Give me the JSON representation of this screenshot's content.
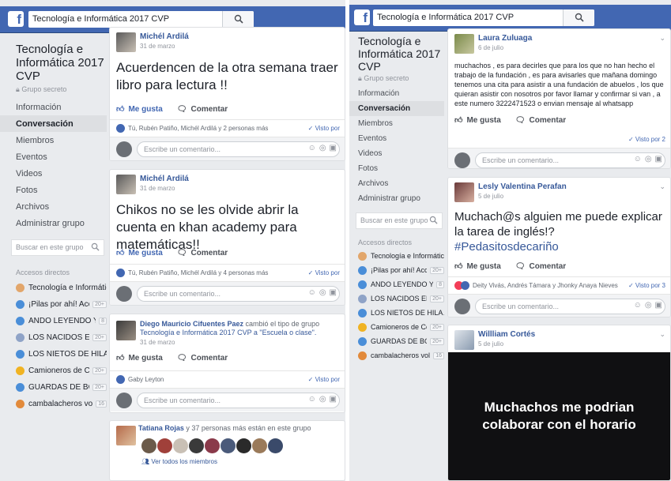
{
  "left": {
    "search_value": "Tecnología e Informática 2017 CVP",
    "group_title": "Tecnología e Informática 2017 CVP",
    "group_privacy": "Grupo secreto",
    "nav": [
      "Información",
      "Conversación",
      "Miembros",
      "Eventos",
      "Videos",
      "Fotos",
      "Archivos",
      "Administrar grupo"
    ],
    "active_nav": "Conversación",
    "side_search_placeholder": "Buscar en este grupo",
    "shortcuts_label": "Accesos directos",
    "shortcuts": [
      {
        "label": "Tecnología e Informátic…",
        "badge": ""
      },
      {
        "label": "¡Pilas por ahí! Acci…",
        "badge": "20+"
      },
      {
        "label": "ANDO LEYENDO Y …",
        "badge": "8"
      },
      {
        "label": "LOS NACIDOS EN…",
        "badge": "20+"
      },
      {
        "label": "LOS NIETOS DE HILA…",
        "badge": ""
      },
      {
        "label": "Camioneros de Col…",
        "badge": "20+"
      },
      {
        "label": "GUARDAS DE BO…",
        "badge": "20+"
      },
      {
        "label": "cambalacheros volk…",
        "badge": "16"
      }
    ],
    "posts": [
      {
        "author": "Michél Ardilá",
        "date": "31 de marzo",
        "text": "Acuerdencen de la otra semana traer libro para lectura !!",
        "like": "Me gusta",
        "comment": "Comentar",
        "reactions": "Tú, Rubén Patiño, Michél Ardilá y 2 personas más",
        "seen": "Visto por",
        "comment_placeholder": "Escribe un comentario..."
      },
      {
        "author": "Michél Ardilá",
        "date": "31 de marzo",
        "text": "Chikos no se les olvide abrir la cuenta en khan academy para matemáticas!!",
        "like": "Me gusta",
        "comment": "Comentar",
        "reactions": "Tú, Rubén Patiño, Michél Ardilá y 4 personas más",
        "seen": "Visto por",
        "comment_placeholder": "Escribe un comentario..."
      },
      {
        "author": "Diego Mauricio Cifuentes Paez",
        "change_text": "cambió el tipo de grupo",
        "detail": "Tecnología e Informática 2017 CVP a \"Escuela o clase\".",
        "date": "31 de marzo",
        "like": "Me gusta",
        "comment": "Comentar",
        "reactions": "Gaby Leyton",
        "seen": "Visto por",
        "comment_placeholder": "Escribe un comentario..."
      }
    ],
    "members": {
      "name": "Tatiana Rojas",
      "text": "y 37 personas más están en este grupo",
      "link": "Ver todos los miembros"
    }
  },
  "right": {
    "search_value": "Tecnología e Informática 2017 CVP",
    "group_title": "Tecnología e Informática 2017 CVP",
    "group_privacy": "Grupo secreto",
    "nav": [
      "Información",
      "Conversación",
      "Miembros",
      "Eventos",
      "Videos",
      "Fotos",
      "Archivos",
      "Administrar grupo"
    ],
    "active_nav": "Conversación",
    "side_search_placeholder": "Buscar en este grupo",
    "shortcuts_label": "Accesos directos",
    "shortcuts": [
      {
        "label": "Tecnología e Informátic…",
        "badge": ""
      },
      {
        "label": "¡Pilas por ahí! Acci…",
        "badge": "20+"
      },
      {
        "label": "ANDO LEYENDO Y …",
        "badge": "8"
      },
      {
        "label": "LOS NACIDOS EN…",
        "badge": "20+"
      },
      {
        "label": "LOS NIETOS DE HILA…",
        "badge": ""
      },
      {
        "label": "Camioneros de Col…",
        "badge": "20+"
      },
      {
        "label": "GUARDAS DE BO…",
        "badge": "20+"
      },
      {
        "label": "cambalacheros volk…",
        "badge": "16"
      }
    ],
    "posts": [
      {
        "author": "Laura Zuluaga",
        "date": "6 de julio",
        "text": "muchachos , es para decirles que para los que no han hecho el trabajo de la fundación , es para avisarles que mañana domingo tenemos una cita para asistir a una fundación de abuelos , los que quieran asistir con nosotros por favor llamar y confirmar si van , a este numero 3222471523 o envian mensaje al whatsapp",
        "like": "Me gusta",
        "comment": "Comentar",
        "seen": "Visto por 2",
        "comment_placeholder": "Escribe un comentario..."
      },
      {
        "author": "Lesly Valentina Perafan",
        "date": "5 de julio",
        "text": "Muchach@s alguien me puede explicar la tarea de inglés!?",
        "hashtag": "#Pedasitosdecariño",
        "like": "Me gusta",
        "comment": "Comentar",
        "reactions": "Deity Vivás, Andrés Támara y Jhonky Anaya Nieves",
        "seen": "Visto por 3",
        "comment_placeholder": "Escribe un comentario..."
      },
      {
        "author": "Willliam Cortés",
        "date": "5 de julio",
        "image_text": "Muchachos me podrian colaborar con el horario"
      }
    ]
  },
  "colors": {
    "brand": "#4267b2",
    "link": "#365899",
    "background": "#e9ebee"
  }
}
